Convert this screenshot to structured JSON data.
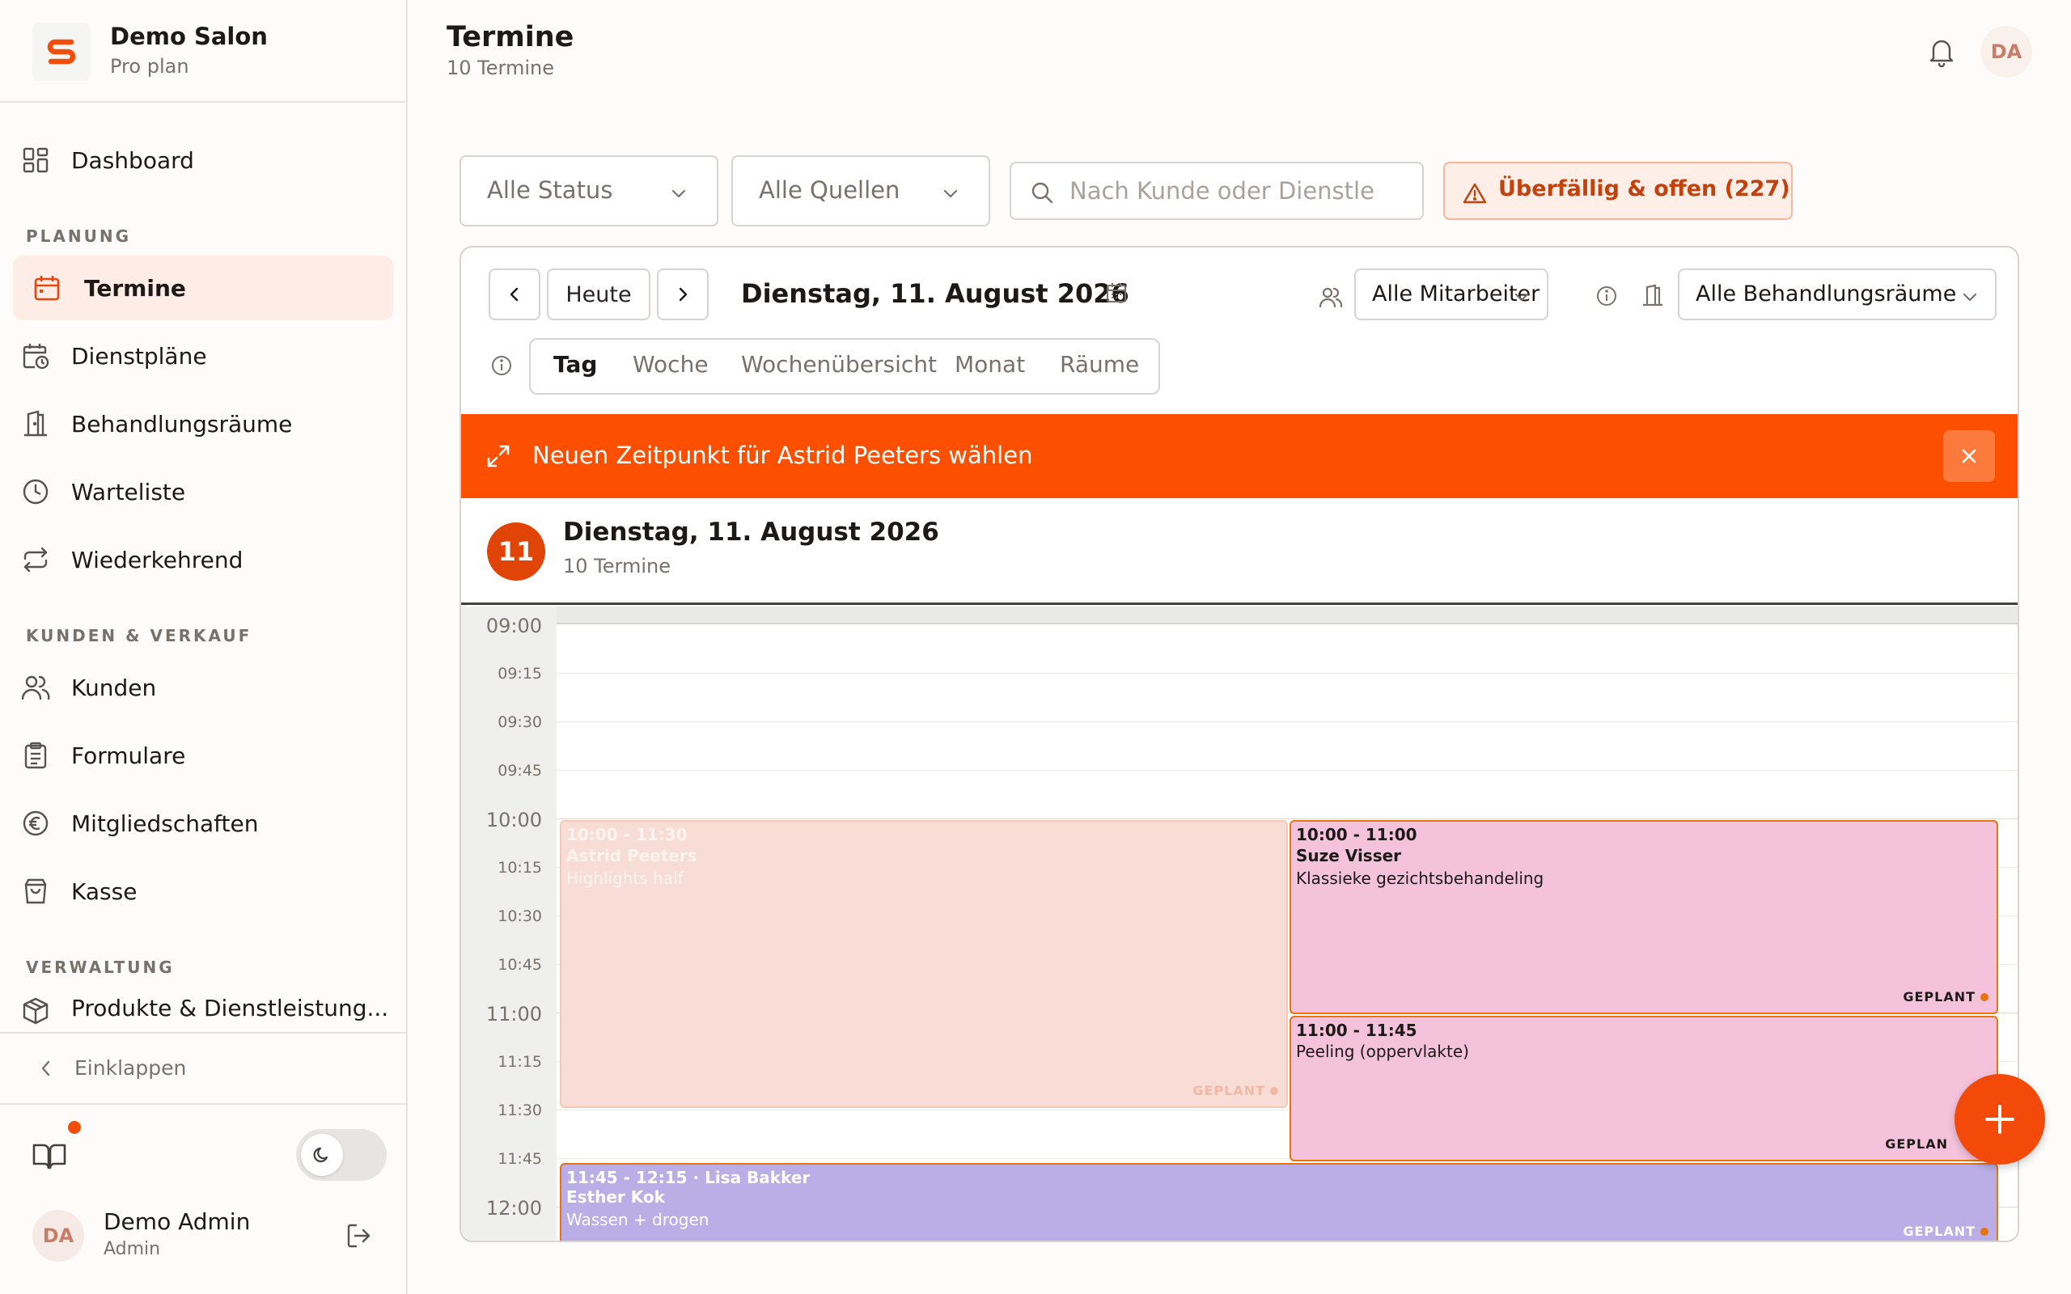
{
  "brand": {
    "logo_letter": "S",
    "name": "Demo Salon",
    "plan": "Pro plan"
  },
  "nav": {
    "dashboard": "Dashboard",
    "section_planning": "PLANUNG",
    "appointments": "Termine",
    "schedules": "Dienstpläne",
    "treatment_rooms": "Behandlungsräume",
    "waitlist": "Warteliste",
    "recurring": "Wiederkehrend",
    "section_customers": "KUNDEN & VERKAUF",
    "customers": "Kunden",
    "forms": "Formulare",
    "memberships": "Mitgliedschaften",
    "checkout": "Kasse",
    "section_admin": "VERWALTUNG",
    "products": "Produkte & Dienstleistung...",
    "collapse": "Einklappen"
  },
  "user": {
    "initials": "DA",
    "name": "Demo Admin",
    "role": "Admin"
  },
  "header": {
    "title": "Termine",
    "subtitle": "10 Termine",
    "avatar_initials": "DA"
  },
  "filters": {
    "status": "Alle Status",
    "sources": "Alle Quellen",
    "search_placeholder": "Nach Kunde oder Dienstle",
    "overdue": "Überfällig & offen (227)"
  },
  "calendar": {
    "today_label": "Heute",
    "date_label": "Dienstag, 11. August 2026",
    "staff_filter": "Alle Mitarbeiter",
    "room_filter": "Alle Behandlungsräume",
    "view_tabs": [
      "Tag",
      "Woche",
      "Wochenübersicht",
      "Monat",
      "Räume"
    ],
    "active_view": "Tag",
    "reschedule_banner": "Neuen Zeitpunkt für Astrid Peeters wählen",
    "day_number": "11",
    "day_title": "Dienstag, 11. August 2026",
    "day_subtitle": "10 Termine",
    "time_slots": [
      "09:00",
      "09:15",
      "09:30",
      "09:45",
      "10:00",
      "10:15",
      "10:30",
      "10:45",
      "11:00",
      "11:15",
      "11:30",
      "11:45",
      "12:00"
    ],
    "appointments": [
      {
        "time": "10:00 - 11:30",
        "client": "Astrid Peeters",
        "service": "Highlights half",
        "status": "GEPLANT",
        "state": "being-rescheduled"
      },
      {
        "time": "10:00 - 11:00",
        "client": "Suze Visser",
        "service": "Klassieke gezichtsbehandeling",
        "status": "GEPLANT"
      },
      {
        "time": "11:00 - 11:45",
        "client": "",
        "service": "Peeling (oppervlakte)",
        "status": "GEPLAN"
      },
      {
        "time": "11:45 - 12:15 · Lisa Bakker",
        "client": "Esther Kok",
        "service": "Wassen + drogen",
        "status": "GEPLANT"
      }
    ]
  },
  "colors": {
    "accent": "#fc4f00",
    "active_nav_bg": "#fdede6",
    "appt_pink": "#f5c2dc",
    "appt_peach": "#f8ddd6",
    "appt_purple": "#bbaee6",
    "appt_border": "#e8730f"
  }
}
